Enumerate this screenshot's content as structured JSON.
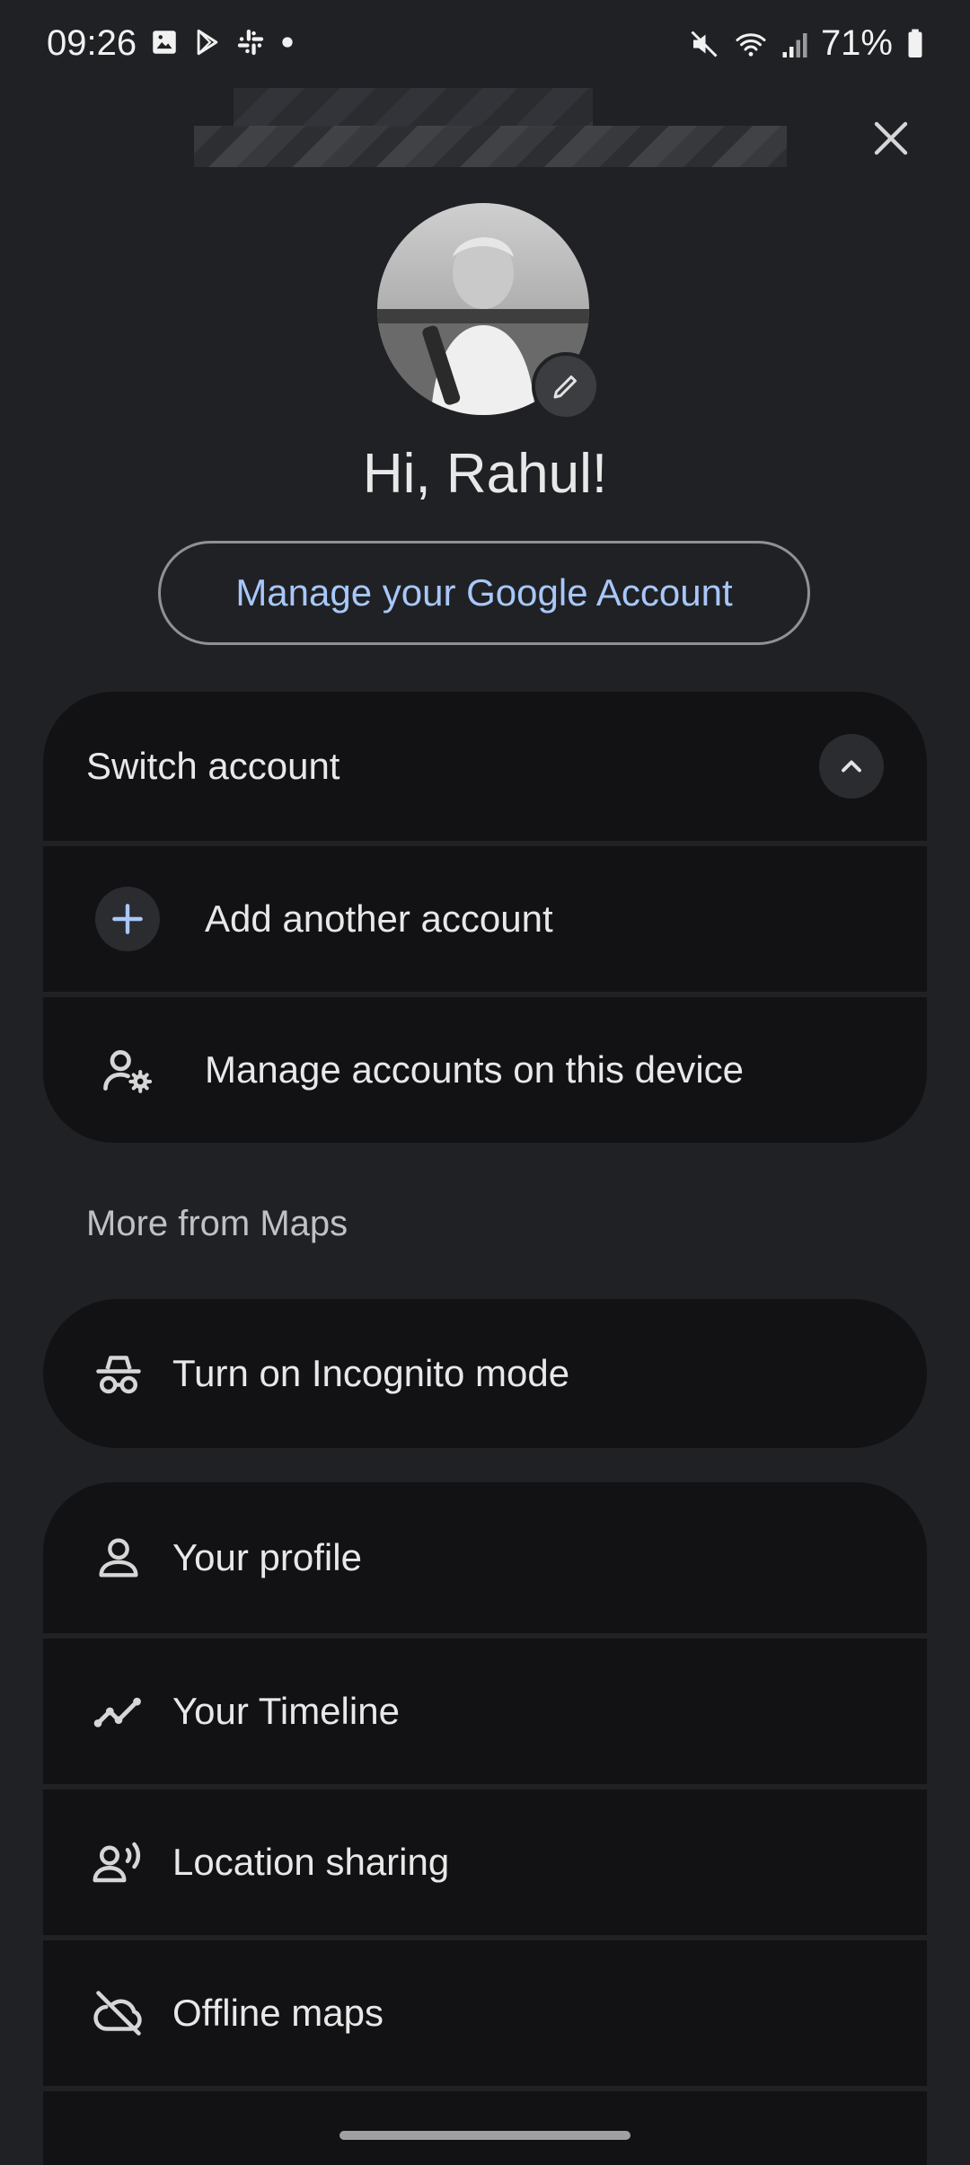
{
  "status_bar": {
    "time": "09:26",
    "battery": "71%",
    "left_icons": [
      "image-icon",
      "play-store-icon",
      "slack-icon",
      "dot-icon"
    ],
    "right_icons": [
      "mute-icon",
      "wifi-icon",
      "signal-icon",
      "battery-icon"
    ]
  },
  "header": {
    "close_icon": "close-icon"
  },
  "profile": {
    "greeting": "Hi, Rahul!",
    "manage_label": "Manage your Google Account",
    "edit_icon": "pencil-icon"
  },
  "switch_account": {
    "title": "Switch account",
    "items": [
      {
        "label": "Add another account",
        "icon": "plus-icon"
      },
      {
        "label": "Manage accounts on this device",
        "icon": "manage-accounts-icon"
      }
    ]
  },
  "more": {
    "section_label": "More from Maps",
    "incognito": {
      "label": "Turn on Incognito mode",
      "icon": "incognito-icon"
    },
    "items": [
      {
        "label": "Your profile",
        "icon": "person-icon"
      },
      {
        "label": "Your Timeline",
        "icon": "timeline-icon"
      },
      {
        "label": "Location sharing",
        "icon": "location-sharing-icon"
      },
      {
        "label": "Offline maps",
        "icon": "cloud-off-icon"
      }
    ]
  },
  "colors": {
    "background": "#202124",
    "card": "#121215",
    "accent_link": "#a8c7fa"
  }
}
